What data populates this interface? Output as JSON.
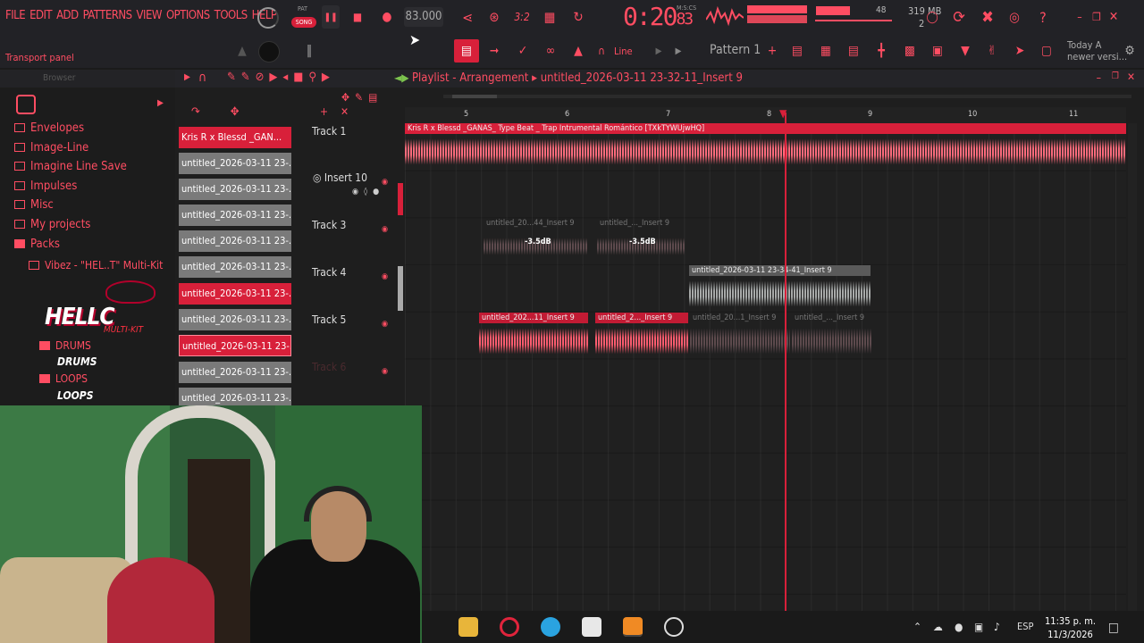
{
  "menu": [
    "FILE",
    "EDIT",
    "ADD",
    "PATTERNS",
    "VIEW",
    "OPTIONS",
    "TOOLS",
    "HELP"
  ],
  "transport": {
    "mode_pat": "PAT",
    "mode_song": "SONG",
    "tempo": "83.000",
    "time_main": "0:20",
    "time_sub": "83",
    "time_unit": "M:S:CS",
    "memory": "319 MB",
    "mem_sub": "2",
    "meter_value": "48"
  },
  "toolbar": {
    "snap": "Line",
    "pattern": "Pattern 1",
    "hint_line1": "Today  A",
    "hint_line2": "newer versi..."
  },
  "transport_panel_label": "Transport panel",
  "browser": {
    "title": "Browser",
    "items": [
      "Envelopes",
      "Image-Line",
      "Imagine Line Save",
      "Impulses",
      "Misc",
      "My projects",
      "Packs"
    ],
    "pack": "Vibez - \"HEL..T\" Multi-Kit",
    "logo": "HELLC",
    "logo_sub": "MULTI-KIT",
    "drums_folder": "DRUMS",
    "drums_label": "DRUMS",
    "loops_folder": "LOOPS",
    "loops_label": "LOOPS"
  },
  "playlist": {
    "title": "Playlist - Arrangement",
    "project": "untitled_2026-03-11 23-32-11_Insert 9",
    "ruler": [
      "5",
      "6",
      "7",
      "8",
      "9",
      "10",
      "11"
    ],
    "clips_list": [
      "Kris R x Blessd _GAN...",
      "untitled_2026-03-11 23-...",
      "untitled_2026-03-11 23-...",
      "untitled_2026-03-11 23-...",
      "untitled_2026-03-11 23-...",
      "untitled_2026-03-11 23-...",
      "untitled_2026-03-11 23-...",
      "untitled_2026-03-11 23-...",
      "untitled_2026-03-11 23-...",
      "untitled_2026-03-11 23-...",
      "untitled_2026-03-11 23-..."
    ],
    "tracks": [
      "Track 1",
      "Insert 10",
      "Track 3",
      "Track 4",
      "Track 5",
      "Track 6"
    ],
    "clip_main": "Kris R x Blessd _GANAS_ Type Beat _ Trap Intrumental Romántico [TXkTYWUjwHQ]",
    "clip_t3a": "untitled_20...44_Insert 9",
    "clip_t3b": "untitled_..._Insert 9",
    "db": "-3.5dB",
    "clip_t4": "untitled_2026-03-11 23-34-41_Insert 9",
    "clip_t5a": "untitled_202...11_Insert 9",
    "clip_t5b": "untitled_2..._Insert 9",
    "clip_t5c": "untitled_20...1_Insert 9",
    "clip_t5d": "untitled_..._Insert 9"
  },
  "taskbar": {
    "lang": "ESP",
    "time": "11:35 p. m.",
    "date": "11/3/2026"
  }
}
